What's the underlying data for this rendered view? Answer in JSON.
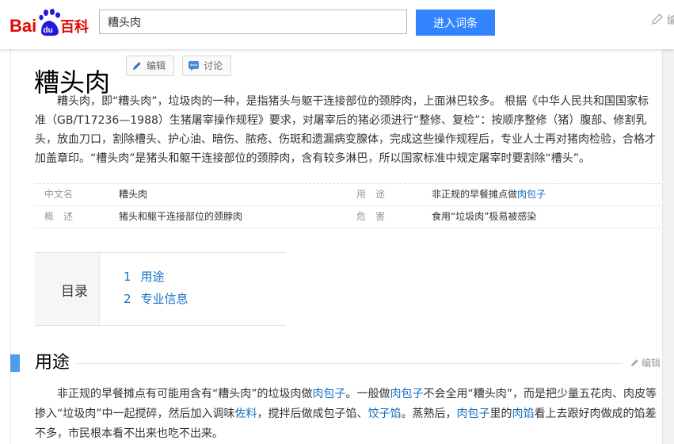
{
  "header": {
    "logo_text": "Bai du 百科",
    "search_value": "糟头肉",
    "search_button": "进入词条",
    "edit_partial": "编"
  },
  "title": {
    "text": "糟头肉",
    "edit_label": "编辑",
    "discuss_label": "讨论"
  },
  "summary": "糟头肉，即“糟头肉”，垃圾肉的一种，是指猪头与躯干连接部位的颈脖肉，上面淋巴较多。 根据《中华人民共和国国家标准（GB/T17236—1988）生猪屠宰操作规程》要求，对屠宰后的猪必须进行“整修、复检”：按顺序整修（猪）腹部、修割乳头，放血刀口，割除槽头、护心油、暗伤、脓疮、伤斑和遗漏病变腺体，完成这些操作规程后，专业人士再对猪肉检验，合格才加盖章印。“槽头肉”是猪头和躯干连接部位的颈脖肉，含有较多淋巴，所以国家标准中规定屠宰时要割除“槽头”。",
  "infobox": {
    "rows": [
      {
        "left_name": "中文名",
        "left_value": "糟头肉",
        "right_name": "用　途",
        "right_value_prefix": "非正规的早餐摊点做",
        "right_value_link": "肉包子"
      },
      {
        "left_name": "概　述",
        "left_value": "猪头和躯干连接部位的颈脖肉",
        "right_name": "危　害",
        "right_value_prefix": "食用“垃圾肉”极易被感染",
        "right_value_link": ""
      }
    ]
  },
  "catalog": {
    "title": "目录",
    "items": [
      {
        "num": "1",
        "label": "用途"
      },
      {
        "num": "2",
        "label": "专业信息"
      }
    ]
  },
  "section": {
    "title": "用途",
    "edit_label": "编辑",
    "para": [
      {
        "t": "非正规的早餐摊点有可能用含有“糟头肉”的垃圾肉做"
      },
      {
        "t": "肉包子",
        "link": true
      },
      {
        "t": "。一般做"
      },
      {
        "t": "肉包子",
        "link": true
      },
      {
        "t": "不会全用“糟头肉”，而是把少量五花肉、肉皮等掺入“垃圾肉”中一起搅碎，然后加入调味"
      },
      {
        "t": "佐料",
        "link": true
      },
      {
        "t": "，搅拌后做成包子馅、"
      },
      {
        "t": "饺子馅",
        "link": true
      },
      {
        "t": "。蒸熟后，"
      },
      {
        "t": "肉包子",
        "link": true
      },
      {
        "t": "里的"
      },
      {
        "t": "肉馅",
        "link": true
      },
      {
        "t": "看上去跟好肉做成的馅差不多，市民根本看不出来也吃不出来。"
      }
    ]
  },
  "colors": {
    "accent": "#3385ff",
    "link": "#136ec2",
    "section_bar": "#4f9cee",
    "logo_red": "#e10601",
    "logo_blue": "#2319dc"
  }
}
